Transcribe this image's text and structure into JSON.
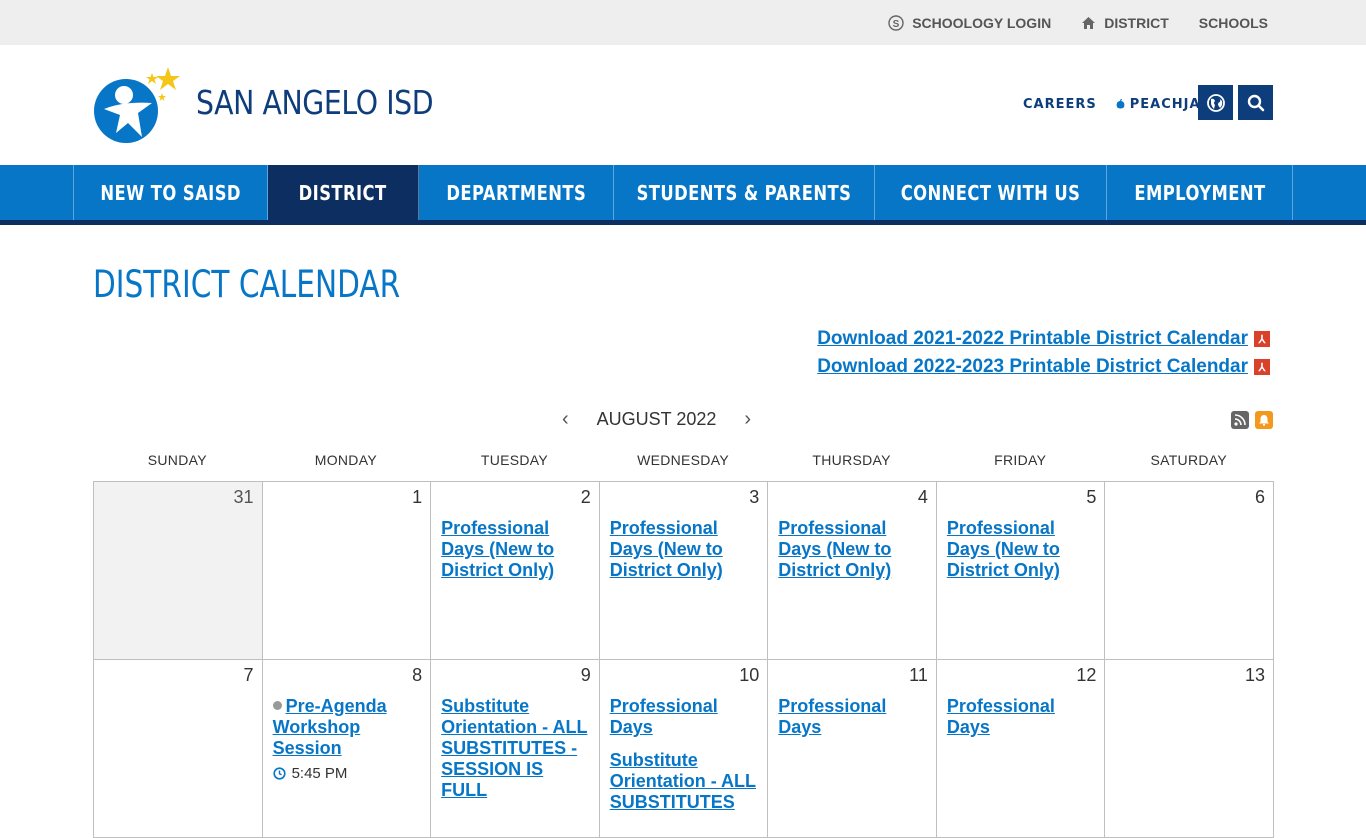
{
  "utility": {
    "schoology": "SCHOOLOGY LOGIN",
    "district": "DISTRICT",
    "schools": "SCHOOLS"
  },
  "header": {
    "site_title": "SAN ANGELO ISD",
    "careers": "CAREERS",
    "peachjar": "PEACHJAR"
  },
  "nav": {
    "items": [
      {
        "label": "NEW TO SAISD"
      },
      {
        "label": "DISTRICT"
      },
      {
        "label": "DEPARTMENTS"
      },
      {
        "label": "STUDENTS & PARENTS"
      },
      {
        "label": "CONNECT WITH US"
      },
      {
        "label": "EMPLOYMENT"
      }
    ]
  },
  "page": {
    "title": "DISTRICT CALENDAR",
    "download_1": "Download 2021-2022 Printable District Calendar",
    "download_2": "Download 2022-2023 Printable District Calendar"
  },
  "calendar": {
    "month_label": "AUGUST 2022",
    "prev_arrow": "‹",
    "next_arrow": "›",
    "days_of_week": [
      "SUNDAY",
      "MONDAY",
      "TUESDAY",
      "WEDNESDAY",
      "THURSDAY",
      "FRIDAY",
      "SATURDAY"
    ],
    "weeks": [
      [
        {
          "day": "31",
          "other": true,
          "events": []
        },
        {
          "day": "1",
          "events": []
        },
        {
          "day": "2",
          "events": [
            {
              "title": "Professional Days (New to District Only)"
            }
          ]
        },
        {
          "day": "3",
          "events": [
            {
              "title": "Professional Days (New to District Only)"
            }
          ]
        },
        {
          "day": "4",
          "events": [
            {
              "title": "Professional Days (New to District Only)"
            }
          ]
        },
        {
          "day": "5",
          "events": [
            {
              "title": "Professional Days (New to District Only)"
            }
          ]
        },
        {
          "day": "6",
          "events": []
        }
      ],
      [
        {
          "day": "7",
          "events": []
        },
        {
          "day": "8",
          "events": [
            {
              "title": "Pre-Agenda Workshop Session",
              "dot": true,
              "time": "5:45 PM"
            }
          ]
        },
        {
          "day": "9",
          "events": [
            {
              "title": "Substitute Orientation - ALL SUBSTITUTES - SESSION IS FULL"
            }
          ]
        },
        {
          "day": "10",
          "events": [
            {
              "title": "Professional Days"
            },
            {
              "title": "Substitute Orientation - ALL SUBSTITUTES"
            }
          ]
        },
        {
          "day": "11",
          "events": [
            {
              "title": "Professional Days"
            }
          ]
        },
        {
          "day": "12",
          "events": [
            {
              "title": "Professional Days"
            }
          ]
        },
        {
          "day": "13",
          "events": []
        }
      ]
    ]
  },
  "colors": {
    "primary_blue": "#0776c7",
    "navy": "#0d3d7a",
    "nav_active": "#0d2e60",
    "pdf_red": "#d9412b",
    "feed_gray": "#666666",
    "feed_orange": "#f39a1e"
  }
}
